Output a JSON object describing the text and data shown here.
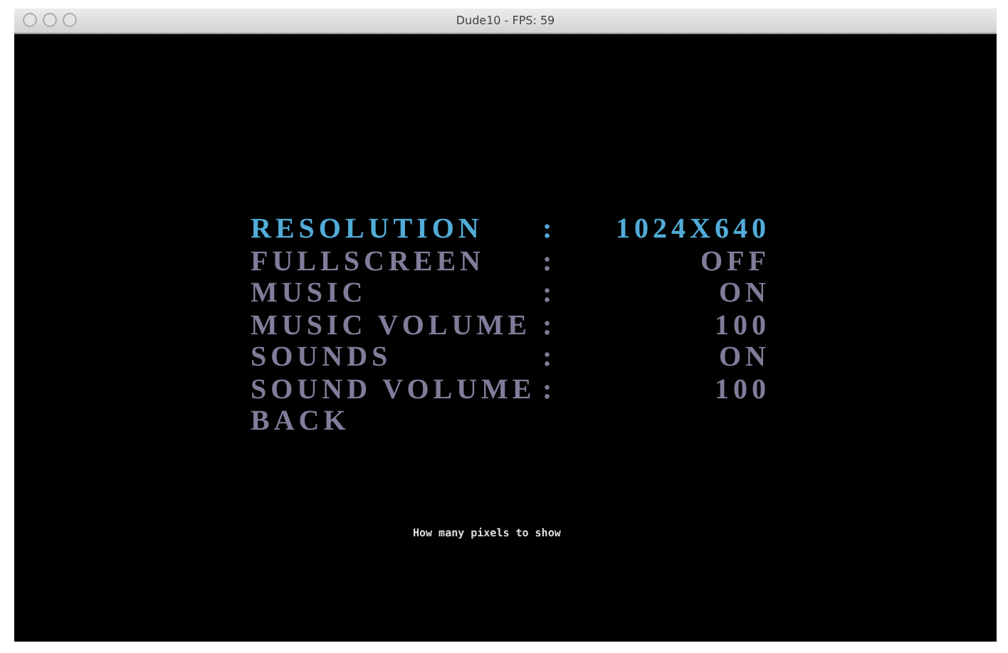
{
  "window": {
    "title": "Dude10 - FPS: 59"
  },
  "menu": [
    {
      "label": "RESOLUTION",
      "separator": ":",
      "value": "1024X640",
      "selected": true
    },
    {
      "label": "FULLSCREEN",
      "separator": ":",
      "value": "OFF",
      "selected": false
    },
    {
      "label": "MUSIC",
      "separator": ":",
      "value": "ON",
      "selected": false
    },
    {
      "label": "MUSIC VOLUME",
      "separator": ":",
      "value": "100",
      "selected": false
    },
    {
      "label": "SOUNDS",
      "separator": ":",
      "value": "ON",
      "selected": false
    },
    {
      "label": "SOUND VOLUME",
      "separator": ":",
      "value": "100",
      "selected": false
    },
    {
      "label": "BACK",
      "selected": false
    }
  ],
  "hint": "How many pixels to show"
}
